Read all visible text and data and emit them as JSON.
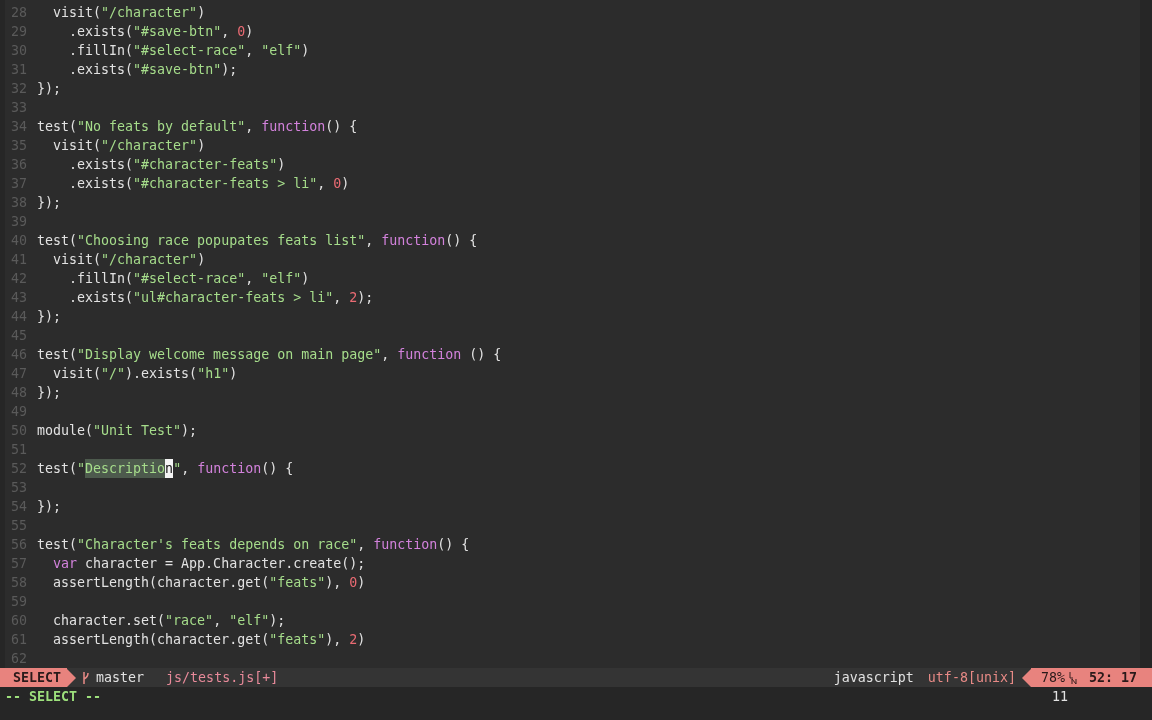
{
  "editor": {
    "lines": [
      {
        "number": "28",
        "tokens": [
          {
            "kind": "plain",
            "text": "  visit("
          },
          {
            "kind": "string",
            "text": "\"/character\""
          },
          {
            "kind": "plain",
            "text": ")"
          }
        ]
      },
      {
        "number": "29",
        "tokens": [
          {
            "kind": "plain",
            "text": "    .exists("
          },
          {
            "kind": "string",
            "text": "\"#save-btn\""
          },
          {
            "kind": "plain",
            "text": ", "
          },
          {
            "kind": "number",
            "text": "0"
          },
          {
            "kind": "plain",
            "text": ")"
          }
        ]
      },
      {
        "number": "30",
        "tokens": [
          {
            "kind": "plain",
            "text": "    .fillIn("
          },
          {
            "kind": "string",
            "text": "\"#select-race\""
          },
          {
            "kind": "plain",
            "text": ", "
          },
          {
            "kind": "string",
            "text": "\"elf\""
          },
          {
            "kind": "plain",
            "text": ")"
          }
        ]
      },
      {
        "number": "31",
        "tokens": [
          {
            "kind": "plain",
            "text": "    .exists("
          },
          {
            "kind": "string",
            "text": "\"#save-btn\""
          },
          {
            "kind": "plain",
            "text": ");"
          }
        ]
      },
      {
        "number": "32",
        "tokens": [
          {
            "kind": "plain",
            "text": "});"
          }
        ]
      },
      {
        "number": "33"
      },
      {
        "number": "34",
        "tokens": [
          {
            "kind": "plain",
            "text": "test("
          },
          {
            "kind": "string",
            "text": "\"No feats by default\""
          },
          {
            "kind": "plain",
            "text": ", "
          },
          {
            "kind": "keyword",
            "text": "function"
          },
          {
            "kind": "plain",
            "text": "() {"
          }
        ]
      },
      {
        "number": "35",
        "tokens": [
          {
            "kind": "plain",
            "text": "  visit("
          },
          {
            "kind": "string",
            "text": "\"/character\""
          },
          {
            "kind": "plain",
            "text": ")"
          }
        ]
      },
      {
        "number": "36",
        "tokens": [
          {
            "kind": "plain",
            "text": "    .exists("
          },
          {
            "kind": "string",
            "text": "\"#character-feats\""
          },
          {
            "kind": "plain",
            "text": ")"
          }
        ]
      },
      {
        "number": "37",
        "tokens": [
          {
            "kind": "plain",
            "text": "    .exists("
          },
          {
            "kind": "string",
            "text": "\"#character-feats > li\""
          },
          {
            "kind": "plain",
            "text": ", "
          },
          {
            "kind": "number",
            "text": "0"
          },
          {
            "kind": "plain",
            "text": ")"
          }
        ]
      },
      {
        "number": "38",
        "tokens": [
          {
            "kind": "plain",
            "text": "});"
          }
        ]
      },
      {
        "number": "39"
      },
      {
        "number": "40",
        "tokens": [
          {
            "kind": "plain",
            "text": "test("
          },
          {
            "kind": "string",
            "text": "\"Choosing race popupates feats list\""
          },
          {
            "kind": "plain",
            "text": ", "
          },
          {
            "kind": "keyword",
            "text": "function"
          },
          {
            "kind": "plain",
            "text": "() {"
          }
        ]
      },
      {
        "number": "41",
        "tokens": [
          {
            "kind": "plain",
            "text": "  visit("
          },
          {
            "kind": "string",
            "text": "\"/character\""
          },
          {
            "kind": "plain",
            "text": ")"
          }
        ]
      },
      {
        "number": "42",
        "tokens": [
          {
            "kind": "plain",
            "text": "    .fillIn("
          },
          {
            "kind": "string",
            "text": "\"#select-race\""
          },
          {
            "kind": "plain",
            "text": ", "
          },
          {
            "kind": "string",
            "text": "\"elf\""
          },
          {
            "kind": "plain",
            "text": ")"
          }
        ]
      },
      {
        "number": "43",
        "tokens": [
          {
            "kind": "plain",
            "text": "    .exists("
          },
          {
            "kind": "string",
            "text": "\"ul#character-feats > li\""
          },
          {
            "kind": "plain",
            "text": ", "
          },
          {
            "kind": "number",
            "text": "2"
          },
          {
            "kind": "plain",
            "text": ");"
          }
        ]
      },
      {
        "number": "44",
        "tokens": [
          {
            "kind": "plain",
            "text": "});"
          }
        ]
      },
      {
        "number": "45"
      },
      {
        "number": "46",
        "tokens": [
          {
            "kind": "plain",
            "text": "test("
          },
          {
            "kind": "string",
            "text": "\"Display welcome message on main page\""
          },
          {
            "kind": "plain",
            "text": ", "
          },
          {
            "kind": "keyword",
            "text": "function"
          },
          {
            "kind": "plain",
            "text": " () {"
          }
        ]
      },
      {
        "number": "47",
        "tokens": [
          {
            "kind": "plain",
            "text": "  visit("
          },
          {
            "kind": "string",
            "text": "\"/\""
          },
          {
            "kind": "plain",
            "text": ").exists("
          },
          {
            "kind": "string",
            "text": "\"h1\""
          },
          {
            "kind": "plain",
            "text": ")"
          }
        ]
      },
      {
        "number": "48",
        "tokens": [
          {
            "kind": "plain",
            "text": "});"
          }
        ]
      },
      {
        "number": "49"
      },
      {
        "number": "50",
        "tokens": [
          {
            "kind": "plain",
            "text": "module("
          },
          {
            "kind": "string",
            "text": "\"Unit Test\""
          },
          {
            "kind": "plain",
            "text": ");"
          }
        ]
      },
      {
        "number": "51"
      },
      {
        "number": "52",
        "tokens": [
          {
            "kind": "plain",
            "text": "test("
          },
          {
            "kind": "string",
            "text": "\""
          },
          {
            "kind": "selection",
            "text": "Descriptio"
          },
          {
            "kind": "cursor",
            "text": "n"
          },
          {
            "kind": "string",
            "text": "\""
          },
          {
            "kind": "plain",
            "text": ", "
          },
          {
            "kind": "keyword",
            "text": "function"
          },
          {
            "kind": "plain",
            "text": "() {"
          }
        ]
      },
      {
        "number": "53"
      },
      {
        "number": "54",
        "tokens": [
          {
            "kind": "plain",
            "text": "});"
          }
        ]
      },
      {
        "number": "55"
      },
      {
        "number": "56",
        "tokens": [
          {
            "kind": "plain",
            "text": "test("
          },
          {
            "kind": "string",
            "text": "\"Character's feats depends on race\""
          },
          {
            "kind": "plain",
            "text": ", "
          },
          {
            "kind": "keyword",
            "text": "function"
          },
          {
            "kind": "plain",
            "text": "() {"
          }
        ]
      },
      {
        "number": "57",
        "tokens": [
          {
            "kind": "keyword",
            "text": "  var"
          },
          {
            "kind": "plain",
            "text": " character = App.Character.create();"
          }
        ]
      },
      {
        "number": "58",
        "tokens": [
          {
            "kind": "plain",
            "text": "  assertLength(character.get("
          },
          {
            "kind": "string",
            "text": "\"feats\""
          },
          {
            "kind": "plain",
            "text": "), "
          },
          {
            "kind": "number",
            "text": "0"
          },
          {
            "kind": "plain",
            "text": ")"
          }
        ]
      },
      {
        "number": "59"
      },
      {
        "number": "60",
        "tokens": [
          {
            "kind": "plain",
            "text": "  character.set("
          },
          {
            "kind": "string",
            "text": "\"race\""
          },
          {
            "kind": "plain",
            "text": ", "
          },
          {
            "kind": "string",
            "text": "\"elf\""
          },
          {
            "kind": "plain",
            "text": ");"
          }
        ]
      },
      {
        "number": "61",
        "tokens": [
          {
            "kind": "plain",
            "text": "  assertLength(character.get("
          },
          {
            "kind": "string",
            "text": "\"feats\""
          },
          {
            "kind": "plain",
            "text": "), "
          },
          {
            "kind": "number",
            "text": "2"
          },
          {
            "kind": "plain",
            "text": ")"
          }
        ]
      },
      {
        "number": "62"
      }
    ]
  },
  "status_bar": {
    "mode": "SELECT",
    "branch": "master",
    "file": "js/tests.js[+]",
    "filetype": "javascript",
    "encoding": "utf-8[unix]",
    "percent": "78%",
    "position": "52: 17"
  },
  "command_line": {
    "message": "-- SELECT --",
    "count": "11"
  }
}
